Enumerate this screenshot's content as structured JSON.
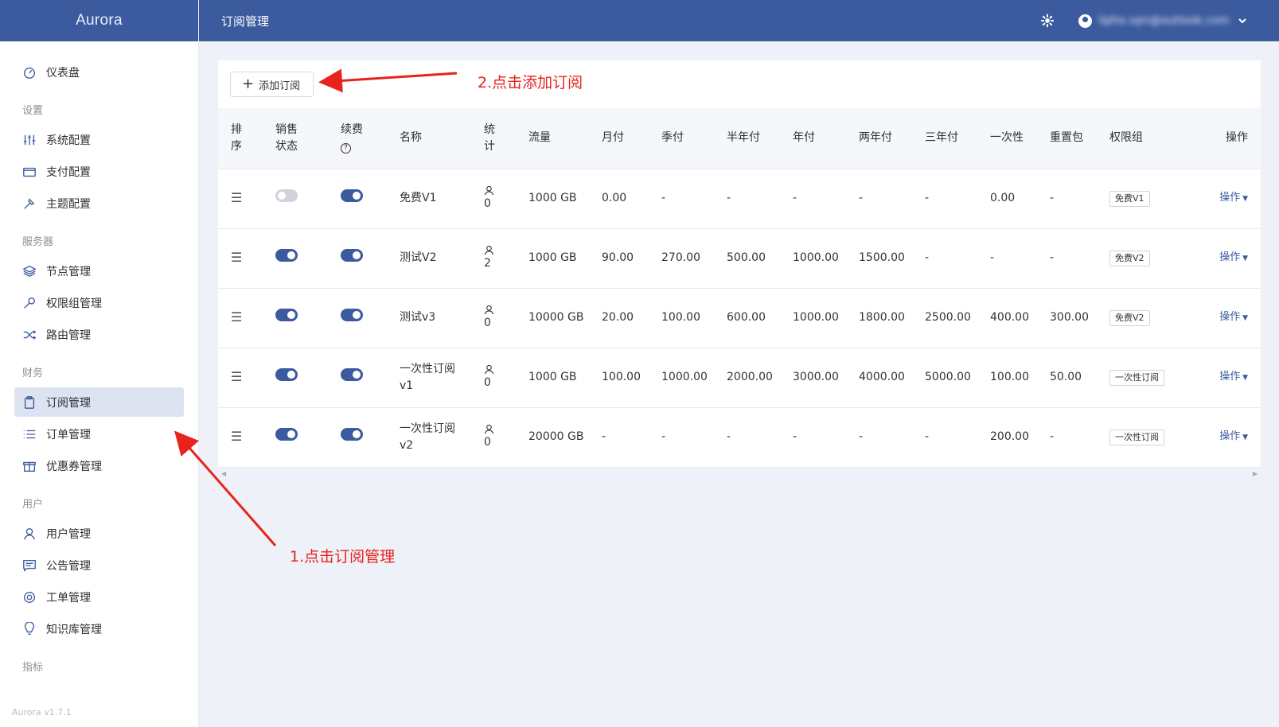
{
  "brand": "Aurora",
  "version": "Aurora v1.7.1",
  "header": {
    "title": "订阅管理",
    "user_email": "lipho.vpn@outlook.com"
  },
  "sidebar": {
    "dashboard": "仪表盘",
    "groups": [
      {
        "title": "设置",
        "items": [
          {
            "label": "系统配置",
            "icon": "sliders-icon"
          },
          {
            "label": "支付配置",
            "icon": "credit-card-icon"
          },
          {
            "label": "主题配置",
            "icon": "brush-icon"
          }
        ]
      },
      {
        "title": "服务器",
        "items": [
          {
            "label": "节点管理",
            "icon": "layers-icon"
          },
          {
            "label": "权限组管理",
            "icon": "wrench-icon"
          },
          {
            "label": "路由管理",
            "icon": "shuffle-icon"
          }
        ]
      },
      {
        "title": "财务",
        "items": [
          {
            "label": "订阅管理",
            "icon": "clipboard-icon",
            "active": true
          },
          {
            "label": "订单管理",
            "icon": "list-icon"
          },
          {
            "label": "优惠券管理",
            "icon": "gift-icon"
          }
        ]
      },
      {
        "title": "用户",
        "items": [
          {
            "label": "用户管理",
            "icon": "user-icon"
          },
          {
            "label": "公告管理",
            "icon": "message-icon"
          },
          {
            "label": "工单管理",
            "icon": "lifebuoy-icon"
          },
          {
            "label": "知识库管理",
            "icon": "bulb-icon"
          }
        ]
      },
      {
        "title": "指标",
        "items": []
      }
    ]
  },
  "toolbar": {
    "add_label": "添加订阅"
  },
  "table": {
    "columns": [
      "排序",
      "销售状态",
      "续费",
      "名称",
      "统计",
      "流量",
      "月付",
      "季付",
      "半年付",
      "年付",
      "两年付",
      "三年付",
      "一次性",
      "重置包",
      "权限组",
      "操作"
    ],
    "rows": [
      {
        "sale": false,
        "renew": true,
        "name": "免费V1",
        "count": "0",
        "traffic": "1000 GB",
        "month": "0.00",
        "quarter": "-",
        "half": "-",
        "year": "-",
        "two": "-",
        "three": "-",
        "once": "0.00",
        "reset": "-",
        "group": "免费V1",
        "op": "操作"
      },
      {
        "sale": true,
        "renew": true,
        "name": "测试V2",
        "count": "2",
        "traffic": "1000 GB",
        "month": "90.00",
        "quarter": "270.00",
        "half": "500.00",
        "year": "1000.00",
        "two": "1500.00",
        "three": "-",
        "once": "-",
        "reset": "-",
        "group": "免费V2",
        "op": "操作"
      },
      {
        "sale": true,
        "renew": true,
        "name": "测试v3",
        "count": "0",
        "traffic": "10000 GB",
        "month": "20.00",
        "quarter": "100.00",
        "half": "600.00",
        "year": "1000.00",
        "two": "1800.00",
        "three": "2500.00",
        "once": "400.00",
        "reset": "300.00",
        "group": "免费V2",
        "op": "操作"
      },
      {
        "sale": true,
        "renew": true,
        "name": "一次性订阅 v1",
        "count": "0",
        "traffic": "1000 GB",
        "month": "100.00",
        "quarter": "1000.00",
        "half": "2000.00",
        "year": "3000.00",
        "two": "4000.00",
        "three": "5000.00",
        "once": "100.00",
        "reset": "50.00",
        "group": "一次性订阅",
        "op": "操作"
      },
      {
        "sale": true,
        "renew": true,
        "name": "一次性订阅 v2",
        "count": "0",
        "traffic": "20000 GB",
        "month": "-",
        "quarter": "-",
        "half": "-",
        "year": "-",
        "two": "-",
        "three": "-",
        "once": "200.00",
        "reset": "-",
        "group": "一次性订阅",
        "op": "操作"
      }
    ]
  },
  "annotations": {
    "step1": "1.点击订阅管理",
    "step2": "2.点击添加订阅",
    "color": "#e8221c"
  },
  "colors": {
    "primary": "#3b5b9e",
    "background": "#eef1f7"
  }
}
